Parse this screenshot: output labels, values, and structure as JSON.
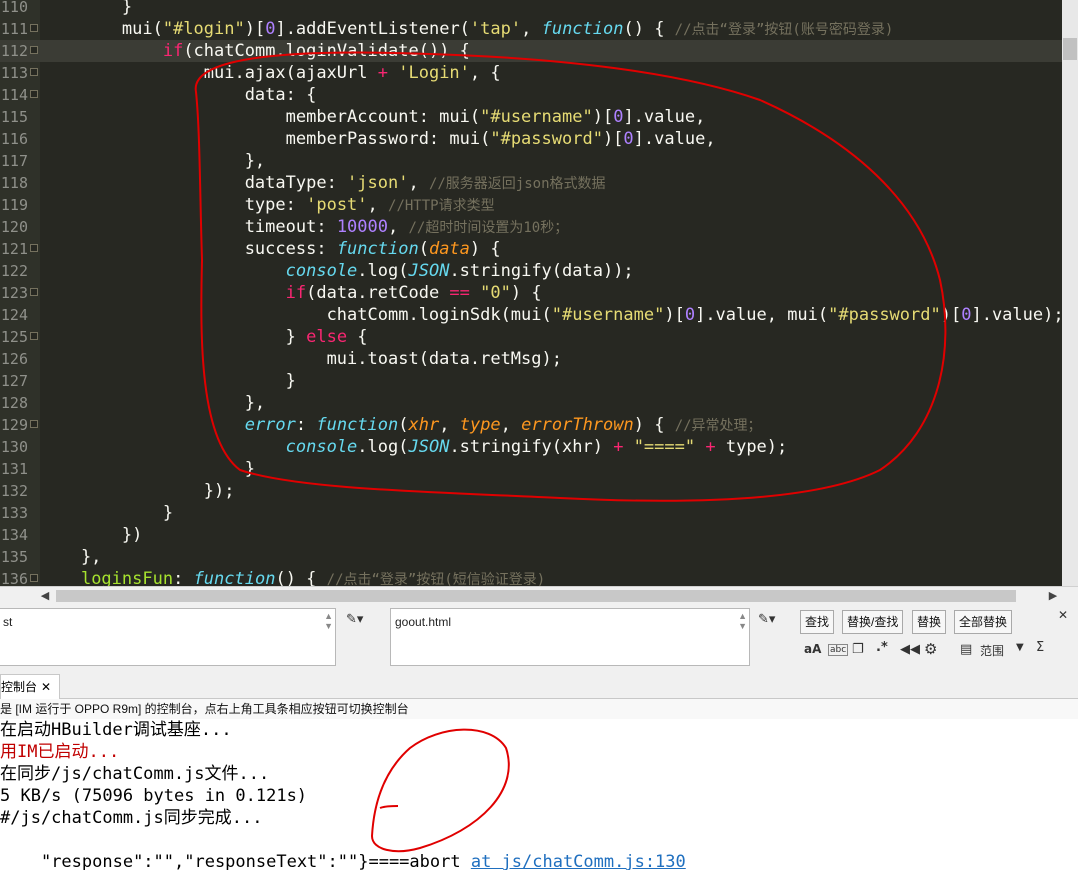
{
  "editor": {
    "lines": [
      {
        "n": "110",
        "fold": false,
        "hl": false,
        "tokens": [
          [
            "",
            "        }"
          ]
        ]
      },
      {
        "n": "111",
        "fold": true,
        "hl": false,
        "tokens": [
          [
            "",
            "        mui("
          ],
          [
            "t-str",
            "\"#login\""
          ],
          [
            "",
            ")["
          ],
          [
            "t-num",
            "0"
          ],
          [
            "",
            "].addEventListener("
          ],
          [
            "t-str",
            "'tap'"
          ],
          [
            "",
            ", "
          ],
          [
            "t-fn",
            "function"
          ],
          [
            "",
            "() { "
          ],
          [
            "t-cmt",
            "//点击“登录”按钮(账号密码登录)"
          ]
        ]
      },
      {
        "n": "112",
        "fold": true,
        "hl": true,
        "tokens": [
          [
            "",
            "            "
          ],
          [
            "t-kw",
            "if"
          ],
          [
            "",
            "(chatComm.loginValidate()) {"
          ]
        ]
      },
      {
        "n": "113",
        "fold": true,
        "hl": false,
        "tokens": [
          [
            "",
            "                mui.ajax(ajaxUrl "
          ],
          [
            "t-kw",
            "+"
          ],
          [
            "t-str",
            " 'Login'"
          ],
          [
            "",
            ", {"
          ]
        ]
      },
      {
        "n": "114",
        "fold": true,
        "hl": false,
        "tokens": [
          [
            "",
            "                    data: {"
          ]
        ]
      },
      {
        "n": "115",
        "fold": false,
        "hl": false,
        "tokens": [
          [
            "",
            "                        memberAccount: mui("
          ],
          [
            "t-str",
            "\"#username\""
          ],
          [
            "",
            ")["
          ],
          [
            "t-num",
            "0"
          ],
          [
            "",
            "].value,"
          ]
        ]
      },
      {
        "n": "116",
        "fold": false,
        "hl": false,
        "tokens": [
          [
            "",
            "                        memberPassword: mui("
          ],
          [
            "t-str",
            "\"#password\""
          ],
          [
            "",
            ")["
          ],
          [
            "t-num",
            "0"
          ],
          [
            "",
            "].value,"
          ]
        ]
      },
      {
        "n": "117",
        "fold": false,
        "hl": false,
        "tokens": [
          [
            "",
            "                    },"
          ]
        ]
      },
      {
        "n": "118",
        "fold": false,
        "hl": false,
        "tokens": [
          [
            "",
            "                    dataType: "
          ],
          [
            "t-str",
            "'json'"
          ],
          [
            "",
            ", "
          ],
          [
            "t-cmt",
            "//服务器返回json格式数据"
          ]
        ]
      },
      {
        "n": "119",
        "fold": false,
        "hl": false,
        "tokens": [
          [
            "",
            "                    type: "
          ],
          [
            "t-str",
            "'post'"
          ],
          [
            "",
            ", "
          ],
          [
            "t-cmt",
            "//HTTP请求类型"
          ]
        ]
      },
      {
        "n": "120",
        "fold": false,
        "hl": false,
        "tokens": [
          [
            "",
            "                    timeout: "
          ],
          [
            "t-num",
            "10000"
          ],
          [
            "",
            ", "
          ],
          [
            "t-cmt",
            "//超时时间设置为10秒；"
          ]
        ]
      },
      {
        "n": "121",
        "fold": true,
        "hl": false,
        "tokens": [
          [
            "",
            "                    success: "
          ],
          [
            "t-fn",
            "function"
          ],
          [
            "",
            "("
          ],
          [
            "t-par",
            "data"
          ],
          [
            "",
            ") {"
          ]
        ]
      },
      {
        "n": "122",
        "fold": false,
        "hl": false,
        "tokens": [
          [
            "",
            "                        "
          ],
          [
            "t-obj",
            "console"
          ],
          [
            "",
            ".log("
          ],
          [
            "t-obj",
            "JSON"
          ],
          [
            "",
            ".stringify(data));"
          ]
        ]
      },
      {
        "n": "123",
        "fold": true,
        "hl": false,
        "tokens": [
          [
            "",
            "                        "
          ],
          [
            "t-kw",
            "if"
          ],
          [
            "",
            "(data.retCode "
          ],
          [
            "t-kw",
            "=="
          ],
          [
            "t-str",
            " \"0\""
          ],
          [
            "",
            ") {"
          ]
        ]
      },
      {
        "n": "124",
        "fold": false,
        "hl": false,
        "tokens": [
          [
            "",
            "                            chatComm.loginSdk(mui("
          ],
          [
            "t-str",
            "\"#username\""
          ],
          [
            "",
            ")["
          ],
          [
            "t-num",
            "0"
          ],
          [
            "",
            "].value, mui("
          ],
          [
            "t-str",
            "\"#password\""
          ],
          [
            "",
            ")["
          ],
          [
            "t-num",
            "0"
          ],
          [
            "",
            "].value);"
          ]
        ]
      },
      {
        "n": "125",
        "fold": true,
        "hl": false,
        "tokens": [
          [
            "",
            "                        } "
          ],
          [
            "t-kw",
            "else"
          ],
          [
            "",
            ""
          ],
          [
            "",
            ""
          ],
          [
            "",
            " {"
          ]
        ]
      },
      {
        "n": "126",
        "fold": false,
        "hl": false,
        "tokens": [
          [
            "",
            "                            mui.toast(data.retMsg);"
          ]
        ]
      },
      {
        "n": "127",
        "fold": false,
        "hl": false,
        "tokens": [
          [
            "",
            "                        }"
          ]
        ]
      },
      {
        "n": "128",
        "fold": false,
        "hl": false,
        "tokens": [
          [
            "",
            "                    },"
          ]
        ]
      },
      {
        "n": "129",
        "fold": true,
        "hl": false,
        "tokens": [
          [
            "",
            "                    "
          ],
          [
            "t-obj",
            "error"
          ],
          [
            "",
            ": "
          ],
          [
            "t-fn",
            "function"
          ],
          [
            "",
            "("
          ],
          [
            "t-par",
            "xhr"
          ],
          [
            "",
            ", "
          ],
          [
            "t-par",
            "type"
          ],
          [
            "",
            ", "
          ],
          [
            "t-par",
            "errorThrown"
          ],
          [
            "",
            ") { "
          ],
          [
            "t-cmt",
            "//异常处理；"
          ]
        ]
      },
      {
        "n": "130",
        "fold": false,
        "hl": false,
        "tokens": [
          [
            "",
            "                        "
          ],
          [
            "t-obj",
            "console"
          ],
          [
            "",
            ".log("
          ],
          [
            "t-obj",
            "JSON"
          ],
          [
            "",
            ".stringify(xhr) "
          ],
          [
            "t-kw",
            "+"
          ],
          [
            "t-str",
            " \"====\""
          ],
          [
            "",
            " "
          ],
          [
            "t-kw",
            "+"
          ],
          [
            "",
            " type);"
          ]
        ]
      },
      {
        "n": "131",
        "fold": false,
        "hl": false,
        "tokens": [
          [
            "",
            "                    }"
          ]
        ]
      },
      {
        "n": "132",
        "fold": false,
        "hl": false,
        "tokens": [
          [
            "",
            "                });"
          ]
        ]
      },
      {
        "n": "133",
        "fold": false,
        "hl": false,
        "tokens": [
          [
            "",
            "            }"
          ]
        ]
      },
      {
        "n": "134",
        "fold": false,
        "hl": false,
        "tokens": [
          [
            "",
            "        })"
          ]
        ]
      },
      {
        "n": "135",
        "fold": false,
        "hl": false,
        "tokens": [
          [
            "",
            "    },"
          ]
        ]
      },
      {
        "n": "136",
        "fold": true,
        "hl": false,
        "tokens": [
          [
            "",
            "    "
          ],
          [
            "t-prop",
            "loginsFun"
          ],
          [
            "",
            ": "
          ],
          [
            "t-fn",
            "function"
          ],
          [
            "",
            "() { "
          ],
          [
            "t-cmt",
            "//点击“登录”按钮(短信验证登录)"
          ]
        ]
      }
    ]
  },
  "findbar": {
    "find_value": "st",
    "replace_value": "goout.html",
    "btn_find": "查找",
    "btn_replace_find": "替换/查找",
    "btn_replace": "替换",
    "btn_replace_all": "全部替换",
    "opt_case": "aA",
    "opt_word": "abc",
    "opt_regex": ".*",
    "scope_label": "范围",
    "sigma": "Σ"
  },
  "console_tab": {
    "label": "控制台",
    "close": "✕"
  },
  "info_text": "是 [IM 运行于 OPPO R9m] 的控制台，点右上角工具条相应按钮可切换控制台",
  "console": {
    "lines": [
      {
        "text": "在启动HBuilder调试基座...",
        "error": false
      },
      {
        "text": "用IM已启动...",
        "error": true
      },
      {
        "text": "在同步/js/chatComm.js文件...",
        "error": false
      },
      {
        "text": "5 KB/s (75096 bytes in 0.121s)",
        "error": false
      },
      {
        "text": "#/js/chatComm.js同步完成...",
        "error": false
      }
    ],
    "last_prefix": "\"response\":\"\",\"responseText\":\"\"}====abort ",
    "last_link": "at js/chatComm.js:130"
  }
}
